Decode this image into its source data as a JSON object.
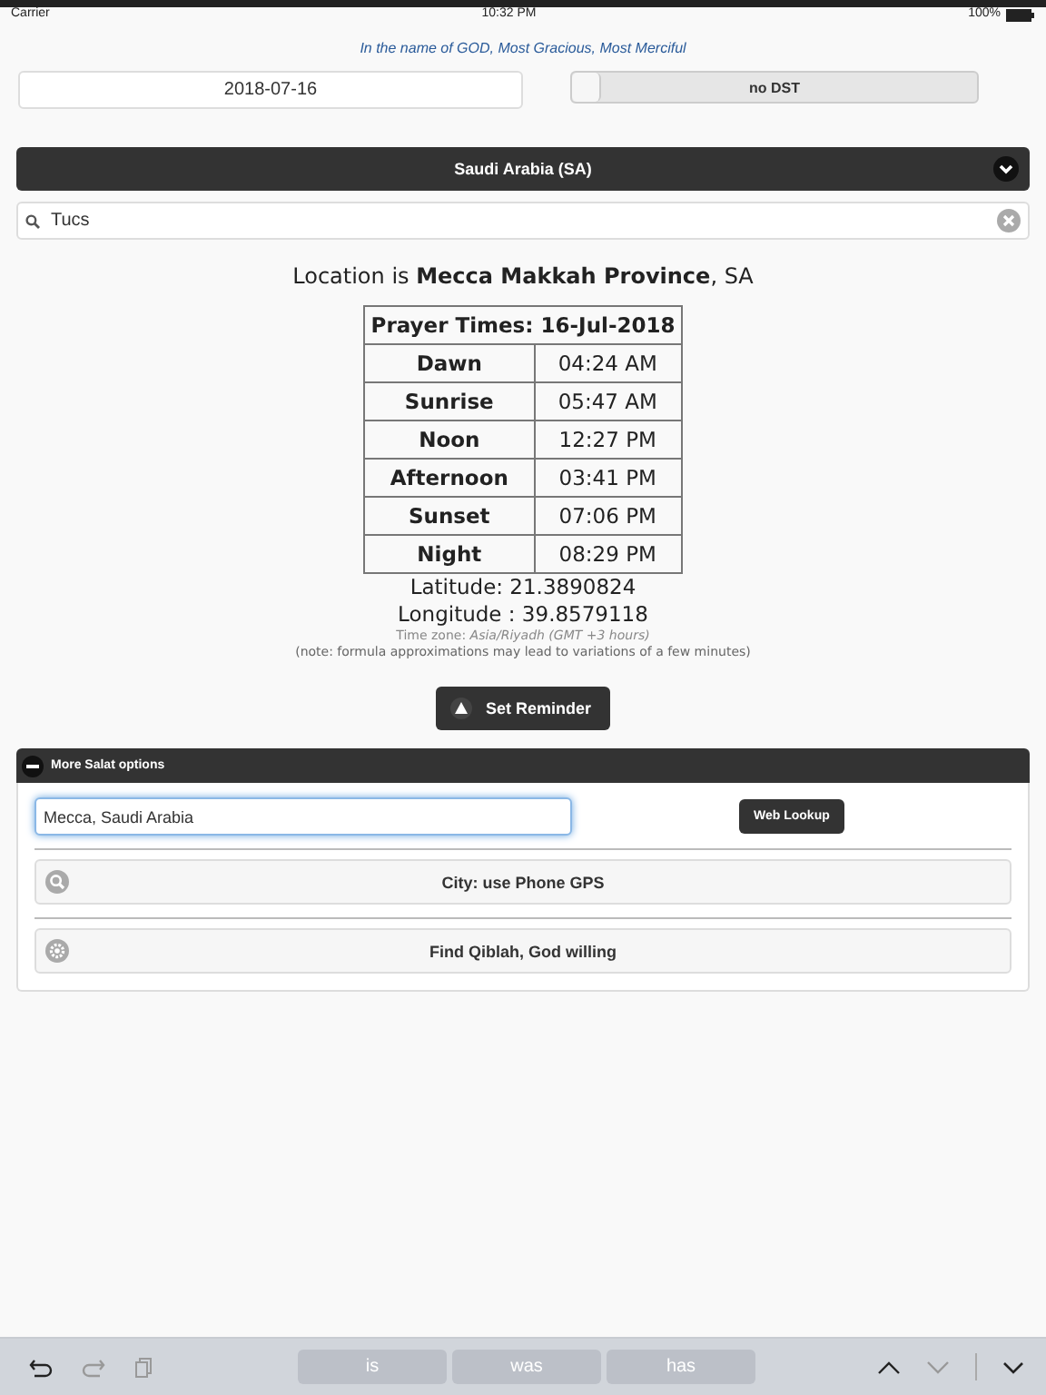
{
  "status_bar": {
    "carrier": "Carrier",
    "time": "10:32 PM",
    "battery": "100%"
  },
  "header": {
    "blessing": "In the name of GOD, Most Gracious, Most Merciful"
  },
  "date_field": {
    "value": "2018-07-16"
  },
  "dst_toggle": {
    "label": "no DST",
    "on": false
  },
  "country_select": {
    "value": "Saudi Arabia (SA)"
  },
  "search": {
    "value": "Tucs"
  },
  "location": {
    "text": "Location is **Mecca Makkah Province**, SA"
  },
  "prayer_table": {
    "title": "Prayer Times: 16-Jul-2018",
    "rows": [
      {
        "name": "Dawn",
        "time": "04:24 AM"
      },
      {
        "name": "Sunrise",
        "time": "05:47 AM"
      },
      {
        "name": "Noon",
        "time": "12:27 PM"
      },
      {
        "name": "Afternoon",
        "time": "03:41 PM"
      },
      {
        "name": "Sunset",
        "time": "07:06 PM"
      },
      {
        "name": "Night",
        "time": "08:29 PM"
      }
    ]
  },
  "coordinates": {
    "latitude": "Latitude: 21.3890824",
    "longitude": "Longitude : 39.8579118"
  },
  "timezone": {
    "text": "Time zone: *Asia/Riyadh (GMT +3 hours)*",
    "note": "(note: formula approximations may lead to variations of a few minutes)"
  },
  "reminder_button": {
    "label": "Set Reminder"
  },
  "options_panel": {
    "title": "More Salat options",
    "expanded": true,
    "city_input": {
      "value": "Mecca, Saudi Arabia",
      "focused": true
    },
    "lookup_button": "Web Lookup",
    "actions": [
      {
        "kind": "search",
        "label": "City: use Phone GPS"
      },
      {
        "kind": "gear",
        "label": "Find Qiblah, God willing"
      }
    ]
  },
  "keyboard_bar": {
    "suggestions": [
      "is",
      "was",
      "has"
    ]
  }
}
